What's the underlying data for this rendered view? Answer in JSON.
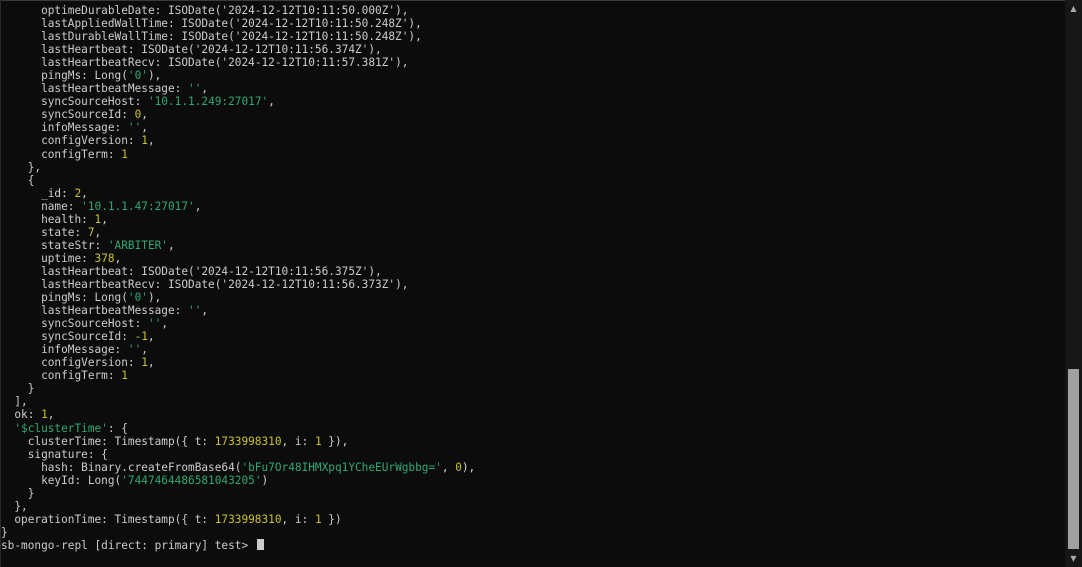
{
  "terminal": {
    "lines": [
      [
        {
          "t": "      optimeDurableDate: ISODate(",
          "c": "plain"
        },
        {
          "t": "'2024-12-12T10:11:50.000Z'",
          "c": "plain"
        },
        {
          "t": "),",
          "c": "plain"
        }
      ],
      [
        {
          "t": "      lastAppliedWallTime: ISODate(",
          "c": "plain"
        },
        {
          "t": "'2024-12-12T10:11:50.248Z'",
          "c": "plain"
        },
        {
          "t": "),",
          "c": "plain"
        }
      ],
      [
        {
          "t": "      lastDurableWallTime: ISODate(",
          "c": "plain"
        },
        {
          "t": "'2024-12-12T10:11:50.248Z'",
          "c": "plain"
        },
        {
          "t": "),",
          "c": "plain"
        }
      ],
      [
        {
          "t": "      lastHeartbeat: ISODate(",
          "c": "plain"
        },
        {
          "t": "'2024-12-12T10:11:56.374Z'",
          "c": "plain"
        },
        {
          "t": "),",
          "c": "plain"
        }
      ],
      [
        {
          "t": "      lastHeartbeatRecv: ISODate(",
          "c": "plain"
        },
        {
          "t": "'2024-12-12T10:11:57.381Z'",
          "c": "plain"
        },
        {
          "t": "),",
          "c": "plain"
        }
      ],
      [
        {
          "t": "      pingMs: Long(",
          "c": "plain"
        },
        {
          "t": "'0'",
          "c": "str"
        },
        {
          "t": "),",
          "c": "plain"
        }
      ],
      [
        {
          "t": "      lastHeartbeatMessage: ",
          "c": "plain"
        },
        {
          "t": "''",
          "c": "str"
        },
        {
          "t": ",",
          "c": "plain"
        }
      ],
      [
        {
          "t": "      syncSourceHost: ",
          "c": "plain"
        },
        {
          "t": "'10.1.1.249:27017'",
          "c": "str"
        },
        {
          "t": ",",
          "c": "plain"
        }
      ],
      [
        {
          "t": "      syncSourceId: ",
          "c": "plain"
        },
        {
          "t": "0",
          "c": "num"
        },
        {
          "t": ",",
          "c": "plain"
        }
      ],
      [
        {
          "t": "      infoMessage: ",
          "c": "plain"
        },
        {
          "t": "''",
          "c": "str"
        },
        {
          "t": ",",
          "c": "plain"
        }
      ],
      [
        {
          "t": "      configVersion: ",
          "c": "plain"
        },
        {
          "t": "1",
          "c": "num"
        },
        {
          "t": ",",
          "c": "plain"
        }
      ],
      [
        {
          "t": "      configTerm: ",
          "c": "plain"
        },
        {
          "t": "1",
          "c": "num"
        }
      ],
      [
        {
          "t": "    },",
          "c": "plain"
        }
      ],
      [
        {
          "t": "    {",
          "c": "plain"
        }
      ],
      [
        {
          "t": "      _id: ",
          "c": "plain"
        },
        {
          "t": "2",
          "c": "num"
        },
        {
          "t": ",",
          "c": "plain"
        }
      ],
      [
        {
          "t": "      name: ",
          "c": "plain"
        },
        {
          "t": "'10.1.1.47:27017'",
          "c": "str"
        },
        {
          "t": ",",
          "c": "plain"
        }
      ],
      [
        {
          "t": "      health: ",
          "c": "plain"
        },
        {
          "t": "1",
          "c": "num"
        },
        {
          "t": ",",
          "c": "plain"
        }
      ],
      [
        {
          "t": "      state: ",
          "c": "plain"
        },
        {
          "t": "7",
          "c": "num"
        },
        {
          "t": ",",
          "c": "plain"
        }
      ],
      [
        {
          "t": "      stateStr: ",
          "c": "plain"
        },
        {
          "t": "'ARBITER'",
          "c": "str"
        },
        {
          "t": ",",
          "c": "plain"
        }
      ],
      [
        {
          "t": "      uptime: ",
          "c": "plain"
        },
        {
          "t": "378",
          "c": "num"
        },
        {
          "t": ",",
          "c": "plain"
        }
      ],
      [
        {
          "t": "      lastHeartbeat: ISODate(",
          "c": "plain"
        },
        {
          "t": "'2024-12-12T10:11:56.375Z'",
          "c": "plain"
        },
        {
          "t": "),",
          "c": "plain"
        }
      ],
      [
        {
          "t": "      lastHeartbeatRecv: ISODate(",
          "c": "plain"
        },
        {
          "t": "'2024-12-12T10:11:56.373Z'",
          "c": "plain"
        },
        {
          "t": "),",
          "c": "plain"
        }
      ],
      [
        {
          "t": "      pingMs: Long(",
          "c": "plain"
        },
        {
          "t": "'0'",
          "c": "str"
        },
        {
          "t": "),",
          "c": "plain"
        }
      ],
      [
        {
          "t": "      lastHeartbeatMessage: ",
          "c": "plain"
        },
        {
          "t": "''",
          "c": "str"
        },
        {
          "t": ",",
          "c": "plain"
        }
      ],
      [
        {
          "t": "      syncSourceHost: ",
          "c": "plain"
        },
        {
          "t": "''",
          "c": "str"
        },
        {
          "t": ",",
          "c": "plain"
        }
      ],
      [
        {
          "t": "      syncSourceId: ",
          "c": "plain"
        },
        {
          "t": "-1",
          "c": "num"
        },
        {
          "t": ",",
          "c": "plain"
        }
      ],
      [
        {
          "t": "      infoMessage: ",
          "c": "plain"
        },
        {
          "t": "''",
          "c": "str"
        },
        {
          "t": ",",
          "c": "plain"
        }
      ],
      [
        {
          "t": "      configVersion: ",
          "c": "plain"
        },
        {
          "t": "1",
          "c": "num"
        },
        {
          "t": ",",
          "c": "plain"
        }
      ],
      [
        {
          "t": "      configTerm: ",
          "c": "plain"
        },
        {
          "t": "1",
          "c": "num"
        }
      ],
      [
        {
          "t": "    }",
          "c": "plain"
        }
      ],
      [
        {
          "t": "  ],",
          "c": "plain"
        }
      ],
      [
        {
          "t": "  ok: ",
          "c": "plain"
        },
        {
          "t": "1",
          "c": "num"
        },
        {
          "t": ",",
          "c": "plain"
        }
      ],
      [
        {
          "t": "  ",
          "c": "plain"
        },
        {
          "t": "'$clusterTime'",
          "c": "str"
        },
        {
          "t": ": {",
          "c": "plain"
        }
      ],
      [
        {
          "t": "    clusterTime: Timestamp({ t: ",
          "c": "plain"
        },
        {
          "t": "1733998310",
          "c": "num"
        },
        {
          "t": ", i: ",
          "c": "plain"
        },
        {
          "t": "1",
          "c": "num"
        },
        {
          "t": " }),",
          "c": "plain"
        }
      ],
      [
        {
          "t": "    signature: {",
          "c": "plain"
        }
      ],
      [
        {
          "t": "      hash: Binary.createFromBase64(",
          "c": "plain"
        },
        {
          "t": "'bFu7Or48IHMXpq1YCheEUrWgbbg='",
          "c": "str"
        },
        {
          "t": ", ",
          "c": "plain"
        },
        {
          "t": "0",
          "c": "num"
        },
        {
          "t": "),",
          "c": "plain"
        }
      ],
      [
        {
          "t": "      keyId: Long(",
          "c": "plain"
        },
        {
          "t": "'7447464486581043205'",
          "c": "str"
        },
        {
          "t": ")",
          "c": "plain"
        }
      ],
      [
        {
          "t": "    }",
          "c": "plain"
        }
      ],
      [
        {
          "t": "  },",
          "c": "plain"
        }
      ],
      [
        {
          "t": "  operationTime: Timestamp({ t: ",
          "c": "plain"
        },
        {
          "t": "1733998310",
          "c": "num"
        },
        {
          "t": ", i: ",
          "c": "plain"
        },
        {
          "t": "1",
          "c": "num"
        },
        {
          "t": " })",
          "c": "plain"
        }
      ],
      [
        {
          "t": "}",
          "c": "plain"
        }
      ]
    ],
    "prompt": "sb-mongo-repl [direct: primary] test> "
  },
  "scrollbar": {
    "up_arrow": "▲",
    "down_arrow": "▼",
    "position_percent": 100
  },
  "colors": {
    "background": "#0c0c0c",
    "text": "#cccccc",
    "number": "#c8c22f",
    "string": "#2fa872",
    "scroll_thumb": "#a0a0a0"
  }
}
